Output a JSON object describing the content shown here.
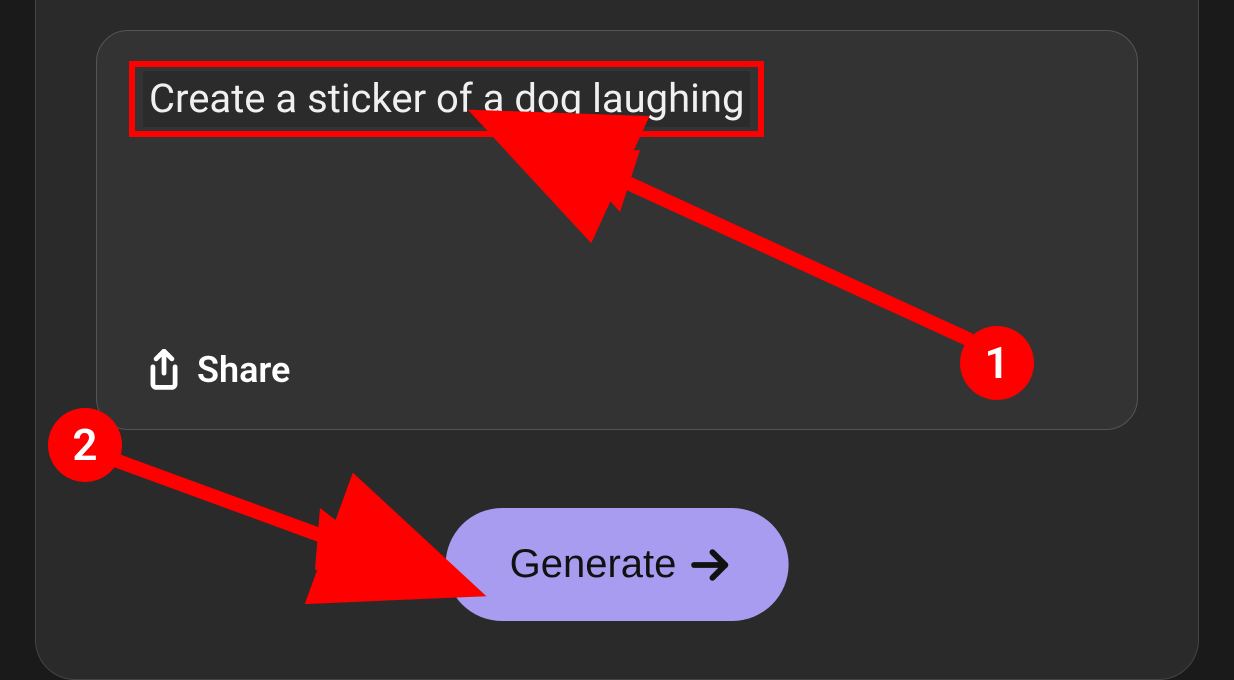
{
  "prompt": {
    "text": "Create a sticker of a dog laughing"
  },
  "share": {
    "label": "Share"
  },
  "generate": {
    "label": "Generate"
  },
  "annotations": {
    "badge1": "1",
    "badge2": "2"
  }
}
